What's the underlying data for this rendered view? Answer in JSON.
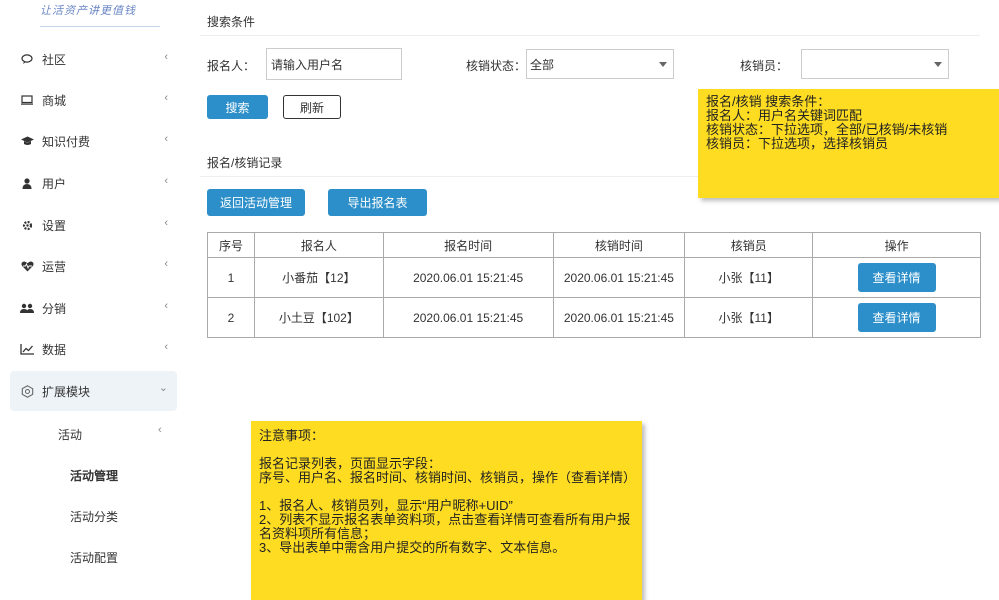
{
  "logo_text": "让活资产讲更值钱",
  "sidebar": {
    "items": [
      {
        "label": "社区",
        "icon": "chat-icon"
      },
      {
        "label": "商城",
        "icon": "monitor-icon"
      },
      {
        "label": "知识付费",
        "icon": "graduation-cap-icon"
      },
      {
        "label": "用户",
        "icon": "user-icon"
      },
      {
        "label": "设置",
        "icon": "gear-icon"
      },
      {
        "label": "运营",
        "icon": "heartbeat-icon"
      },
      {
        "label": "分销",
        "icon": "users-icon"
      },
      {
        "label": "数据",
        "icon": "line-chart-icon"
      },
      {
        "label": "扩展模块",
        "icon": "hexagon-icon"
      }
    ],
    "sub_group": "活动",
    "sub_items": [
      "活动管理",
      "活动分类",
      "活动配置"
    ]
  },
  "search": {
    "section_title": "搜索条件",
    "name_label": "报名人：",
    "name_value": "请输入用户名",
    "status_label": "核销状态：",
    "status_value": "全部",
    "staff_label": "核销员：",
    "staff_value": "",
    "search_btn": "搜索",
    "refresh_btn": "刷新"
  },
  "records": {
    "section_title": "报名/核销记录",
    "back_btn": "返回活动管理",
    "export_btn": "导出报名表",
    "columns": [
      "序号",
      "报名人",
      "报名时间",
      "核销时间",
      "核销员",
      "操作"
    ],
    "rows": [
      {
        "no": "1",
        "name": "小番茄【12】",
        "signup": "2020.06.01 15:21:45",
        "verify": "2020.06.01 15:21:45",
        "staff": "小张【11】",
        "action": "查看详情"
      },
      {
        "no": "2",
        "name": "小土豆【102】",
        "signup": "2020.06.01 15:21:45",
        "verify": "2020.06.01 15:21:45",
        "staff": "小张【11】",
        "action": "查看详情"
      }
    ]
  },
  "note_top": {
    "lines": [
      "报名/核销 搜索条件：",
      "报名人：用户名关键词匹配",
      "核销状态：下拉选项，全部/已核销/未核销",
      "核销员：下拉选项，选择核销员"
    ]
  },
  "note_bottom": {
    "title": "注意事项：",
    "intro": "报名记录列表，页面显示字段：",
    "fields": "序号、用户名、报名时间、核销时间、核销员，操作（查看详情）",
    "rule1": "1、报名人、核销员列，显示“用户昵称+UID”",
    "rule2": "2、列表不显示报名表单资料项，点击查看详情可查看所有用户报名资料项所有信息；",
    "rule3": "3、导出表单中需含用户提交的所有数字、文本信息。"
  }
}
